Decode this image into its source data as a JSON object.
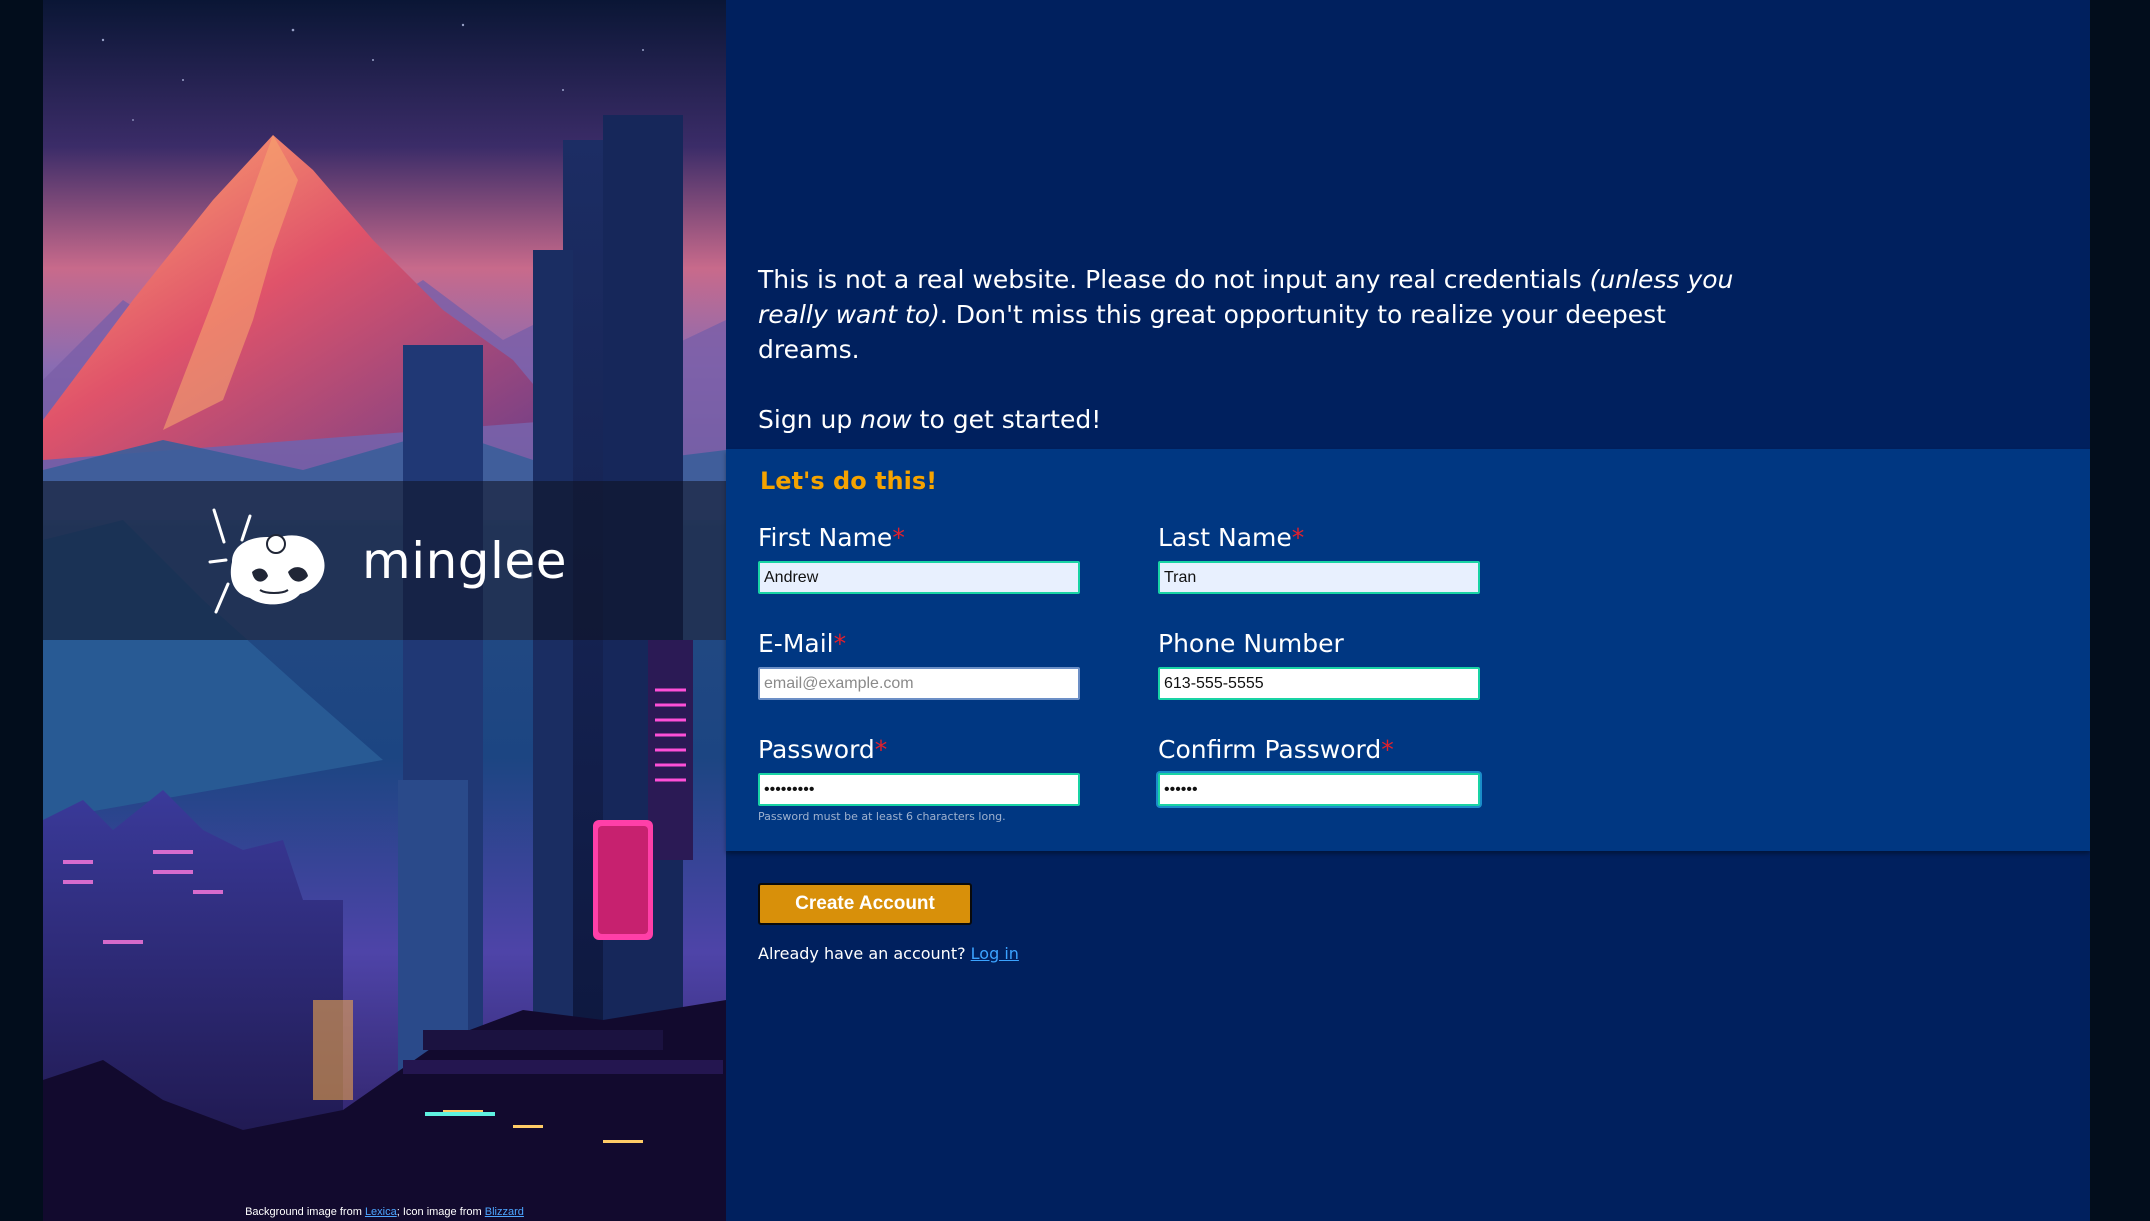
{
  "brand": {
    "name": "minglee"
  },
  "credits": {
    "prefix": "Background image from ",
    "lexica_link": "Lexica",
    "middle": "; Icon image from ",
    "blizzard_link": "Blizzard"
  },
  "intro": {
    "line1_a": "This is not a real website. Please do not input any real credentials ",
    "line1_em": "(unless you really want to)",
    "line1_b": ". Don't miss this great opportunity to realize your deepest dreams.",
    "line2_a": "Sign up ",
    "line2_em": "now",
    "line2_b": " to get started!"
  },
  "form": {
    "heading": "Let's do this!",
    "required_mark": "*",
    "first_name": {
      "label": "First Name",
      "value": "Andrew"
    },
    "last_name": {
      "label": "Last Name",
      "value": "Tran"
    },
    "email": {
      "label": "E-Mail",
      "value": "",
      "placeholder": "email@example.com"
    },
    "phone": {
      "label": "Phone Number",
      "value": "613-555-5555"
    },
    "password": {
      "label": "Password",
      "value": "abcdefghi",
      "hint": "Password must be at least 6 characters long."
    },
    "confirm_password": {
      "label": "Confirm Password",
      "value": "abcdef"
    }
  },
  "actions": {
    "create_label": "Create Account",
    "login_prompt": "Already have an account? ",
    "login_link": "Log in"
  },
  "colors": {
    "main_bg": "#00205e",
    "panel_bg": "#003782",
    "heading_accent": "#f5a300",
    "button_bg": "#d8900a",
    "required": "#e3202b",
    "link": "#3ba3ff",
    "input_border": "#19d3a4"
  }
}
